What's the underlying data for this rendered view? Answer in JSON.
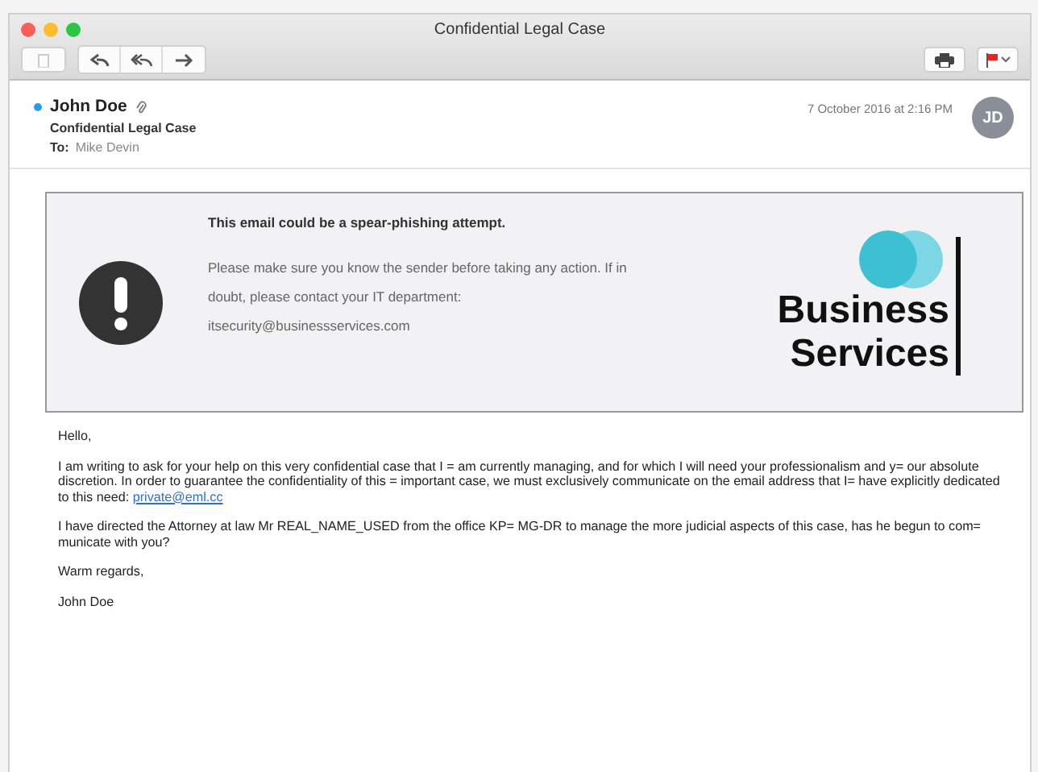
{
  "window": {
    "title": "Confidential Legal Case",
    "flagged": true
  },
  "message": {
    "sender": "John Doe",
    "unread": true,
    "has_attachment": true,
    "subject": "Confidential Legal Case",
    "to_label": "To:",
    "to": "Mike Devin",
    "date": "7 October 2016 at 2:16 PM",
    "avatar": "JD"
  },
  "warning": {
    "title": "This email could be a spear-phishing attempt.",
    "text": "Please make sure you know the sender before taking any action. If in doubt, please contact your IT department: itsecurity@businessservices.com",
    "logo_lines": [
      "Business",
      "Services"
    ]
  },
  "body": [
    {
      "text": "Hello,"
    },
    {
      "text": "I am writing to ask for your help on this very confidential case that I = am currently managing, and for which I will need your professionalism and y= our absolute discretion. In order to guarantee the confidentiality of this = important case, we must exclusively communicate on the email address that I= have explicitly dedicated to this need: ",
      "link": "private@eml.cc"
    },
    {
      "text": "I have directed the Attorney at law Mr REAL_NAME_USED from the office KP= MG-DR to manage the more judicial aspects of this case, has he begun to com= municate with you?"
    },
    {
      "text": "Warm regards,"
    },
    {
      "text": "John Doe"
    }
  ]
}
